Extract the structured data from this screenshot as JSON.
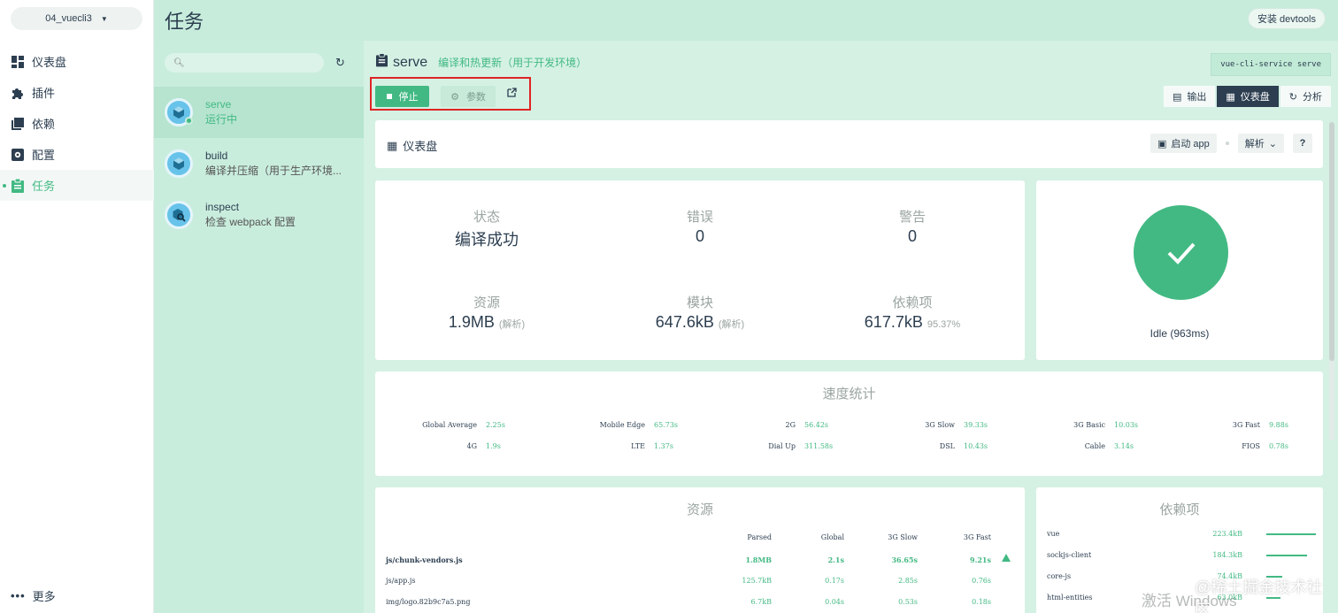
{
  "project": {
    "name": "04_vuecli3"
  },
  "nav": {
    "items": [
      {
        "label": "仪表盘",
        "icon": "dashboard-icon"
      },
      {
        "label": "插件",
        "icon": "puzzle-icon"
      },
      {
        "label": "依赖",
        "icon": "book-icon"
      },
      {
        "label": "配置",
        "icon": "gear-icon"
      },
      {
        "label": "任务",
        "icon": "clipboard-icon"
      }
    ],
    "more": "更多"
  },
  "header": {
    "title": "任务",
    "devtools": "安装 devtools"
  },
  "tasks": [
    {
      "name": "serve",
      "desc": "运行中"
    },
    {
      "name": "build",
      "desc": "编译并压缩（用于生产环境..."
    },
    {
      "name": "inspect",
      "desc": "检查 webpack 配置"
    }
  ],
  "task": {
    "name": "serve",
    "desc": "编译和热更新（用于开发环境）",
    "command": "vue-cli-service serve",
    "stop": "停止",
    "params": "参数"
  },
  "views": {
    "output": "输出",
    "dashboard": "仪表盘",
    "analyze": "分析"
  },
  "dashboard": {
    "title": "仪表盘",
    "open_app": "启动 app",
    "mode": "解析",
    "help": "?"
  },
  "stats": {
    "status_label": "状态",
    "status_value": "编译成功",
    "errors_label": "错误",
    "errors_value": "0",
    "warnings_label": "警告",
    "warnings_value": "0",
    "assets_label": "资源",
    "assets_value": "1.9MB",
    "assets_note": "(解析)",
    "modules_label": "模块",
    "modules_value": "647.6kB",
    "modules_note": "(解析)",
    "deps_label": "依赖项",
    "deps_value": "617.7kB",
    "deps_note": "95.37%"
  },
  "status": {
    "text": "Idle (963ms)"
  },
  "speed": {
    "title": "速度统计",
    "row1": [
      {
        "k": "Global Average",
        "v": "2.25s"
      },
      {
        "k": "Mobile Edge",
        "v": "65.73s"
      },
      {
        "k": "2G",
        "v": "56.42s"
      },
      {
        "k": "3G Slow",
        "v": "39.33s"
      },
      {
        "k": "3G Basic",
        "v": "10.03s"
      },
      {
        "k": "3G Fast",
        "v": "9.88s"
      }
    ],
    "row2": [
      {
        "k": "4G",
        "v": "1.9s"
      },
      {
        "k": "LTE",
        "v": "1.37s"
      },
      {
        "k": "Dial Up",
        "v": "311.58s"
      },
      {
        "k": "DSL",
        "v": "10.43s"
      },
      {
        "k": "Cable",
        "v": "3.14s"
      },
      {
        "k": "FIOS",
        "v": "0.78s"
      }
    ]
  },
  "assets": {
    "title": "资源",
    "headers": [
      "Parsed",
      "Global",
      "3G Slow",
      "3G Fast"
    ],
    "rows": [
      {
        "file": "js/chunk-vendors.js",
        "parsed": "1.8MB",
        "global": "2.1s",
        "slow": "36.65s",
        "fast": "9.21s"
      },
      {
        "file": "js/app.js",
        "parsed": "125.7kB",
        "global": "0.17s",
        "slow": "2.85s",
        "fast": "0.76s"
      },
      {
        "file": "img/logo.82b9c7a5.png",
        "parsed": "6.7kB",
        "global": "0.04s",
        "slow": "0.53s",
        "fast": "0.18s"
      }
    ]
  },
  "deps": {
    "title": "依赖项",
    "rows": [
      {
        "name": "vue",
        "size": "223.4kB",
        "share": 1.0
      },
      {
        "name": "sockjs-client",
        "size": "184.3kB",
        "share": 0.82
      },
      {
        "name": "core-js",
        "size": "74.4kB",
        "share": 0.33
      },
      {
        "name": "html-entities",
        "size": "63.0kB",
        "share": 0.28
      }
    ]
  },
  "watermark": {
    "a": "激活 Windows",
    "b": "@稀土掘金技术社区"
  },
  "colors": {
    "accent": "#42b983",
    "dark": "#2c3e50",
    "highlight": "#e02424"
  }
}
